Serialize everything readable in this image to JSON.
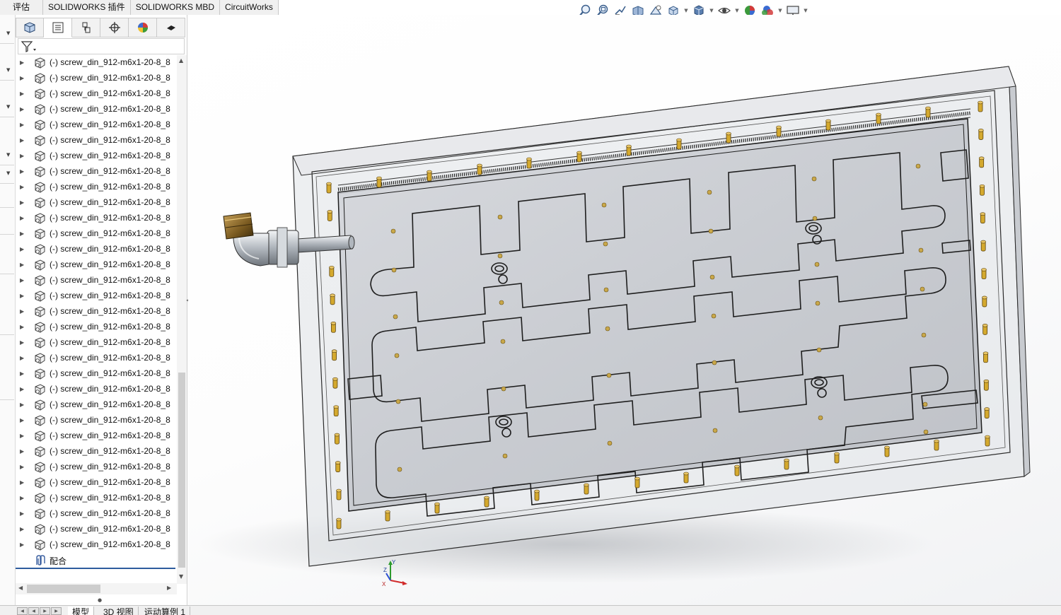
{
  "command_tabs": [
    "评估",
    "SOLIDWORKS 插件",
    "SOLIDWORKS MBD",
    "CircuitWorks"
  ],
  "hud_icons": [
    "zoom-to-fit-icon",
    "zoom-to-area-icon",
    "previous-view-icon",
    "section-view-icon",
    "dynamic-annotation-icon",
    "view-orientation-icon",
    "display-style-icon",
    "hide-show-icon",
    "edit-appearance-icon",
    "apply-scene-icon",
    "view-settings-icon"
  ],
  "feature_manager": {
    "tabs": [
      "featuremanager-tree-icon",
      "property-manager-icon",
      "configuration-manager-icon",
      "dimxpert-manager-icon",
      "display-manager-icon",
      "cam-manager-icon"
    ],
    "filter_icon": "filter-icon",
    "tree_items": [
      "(-) screw_din_912-m6x1-20-8_8",
      "(-) screw_din_912-m6x1-20-8_8",
      "(-) screw_din_912-m6x1-20-8_8",
      "(-) screw_din_912-m6x1-20-8_8",
      "(-) screw_din_912-m6x1-20-8_8",
      "(-) screw_din_912-m6x1-20-8_8",
      "(-) screw_din_912-m6x1-20-8_8",
      "(-) screw_din_912-m6x1-20-8_8",
      "(-) screw_din_912-m6x1-20-8_8",
      "(-) screw_din_912-m6x1-20-8_8",
      "(-) screw_din_912-m6x1-20-8_8",
      "(-) screw_din_912-m6x1-20-8_8",
      "(-) screw_din_912-m6x1-20-8_8",
      "(-) screw_din_912-m6x1-20-8_8",
      "(-) screw_din_912-m6x1-20-8_8",
      "(-) screw_din_912-m6x1-20-8_8",
      "(-) screw_din_912-m6x1-20-8_8",
      "(-) screw_din_912-m6x1-20-8_8",
      "(-) screw_din_912-m6x1-20-8_8",
      "(-) screw_din_912-m6x1-20-8_8",
      "(-) screw_din_912-m6x1-20-8_8",
      "(-) screw_din_912-m6x1-20-8_8",
      "(-) screw_din_912-m6x1-20-8_8",
      "(-) screw_din_912-m6x1-20-8_8",
      "(-) screw_din_912-m6x1-20-8_8",
      "(-) screw_din_912-m6x1-20-8_8",
      "(-) screw_din_912-m6x1-20-8_8",
      "(-) screw_din_912-m6x1-20-8_8",
      "(-) screw_din_912-m6x1-20-8_8",
      "(-) screw_din_912-m6x1-20-8_8",
      "(-) screw_din_912-m6x1-20-8_8",
      "(-) screw_din_912-m6x1-20-8_8",
      "(-) screw_din_912-m6x1-20-8_8",
      "(-) screw_din_912-m6x1-20-8_8"
    ],
    "mates_label": "配合"
  },
  "bottom_tabs": [
    "模型",
    "3D 视图",
    "运动算例 1"
  ],
  "triad": {
    "x_label": "X",
    "y_label": "Y",
    "z_label": "Z"
  },
  "colors": {
    "accent_blue": "#2e5c9e",
    "plate_fill": "#c3c6cc",
    "plate_edge": "#1e1e1e",
    "screw_gold": "#d4a92e",
    "fitting_brass": "#7a5a20"
  }
}
